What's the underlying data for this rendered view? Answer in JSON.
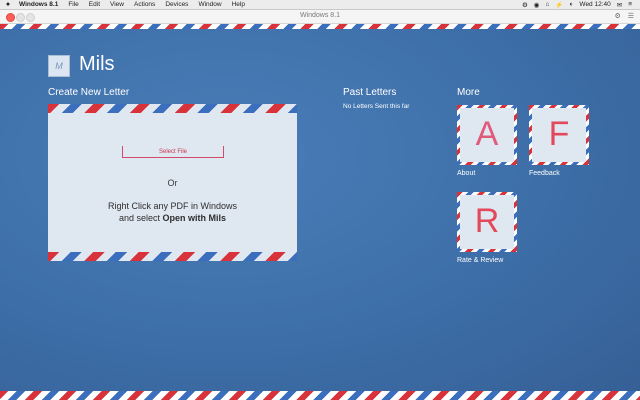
{
  "menubar": {
    "app_name": "Windows 8.1",
    "items": [
      "File",
      "Edit",
      "View",
      "Actions",
      "Devices",
      "Window",
      "Help"
    ],
    "clock": "Wed 12:40",
    "status_glyphs": [
      "⚙",
      "◉",
      "⌂",
      "⚡",
      "◐",
      "☰",
      "✉",
      "≡"
    ]
  },
  "window": {
    "title": "Windows 8.1"
  },
  "app": {
    "name": "Mils",
    "logo_letter": "M",
    "create": {
      "title": "Create New Letter",
      "select_label": "Select File",
      "or_text": "Or",
      "hint_line1": "Right Click any PDF in Windows",
      "hint_line2_prefix": "and select",
      "hint_line2_bold": "Open with Mils"
    },
    "past": {
      "title": "Past Letters",
      "empty_text": "No Letters Sent this far"
    },
    "more": {
      "title": "More",
      "tiles": [
        {
          "letter": "A",
          "label": "About",
          "color": "#e05a7a"
        },
        {
          "letter": "F",
          "label": "Feedback",
          "color": "#e24a5c"
        },
        {
          "letter": "R",
          "label": "Rate & Review",
          "color": "#e24a5c"
        }
      ]
    }
  }
}
